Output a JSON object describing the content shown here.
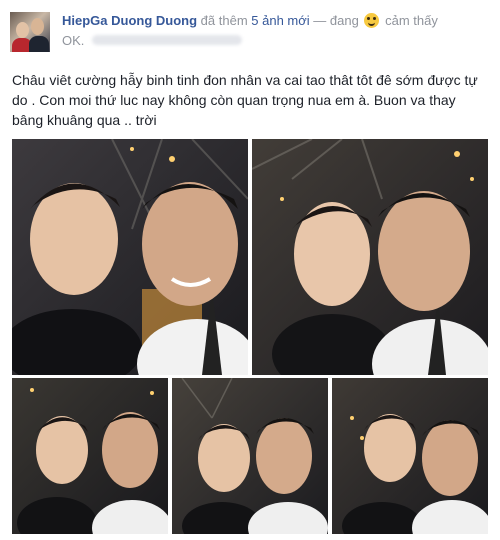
{
  "post": {
    "author": "HiepGa Duong Duong",
    "action_prefix": "đã thêm",
    "photos_link": "5 ảnh mới",
    "feeling_prefix": "— đang",
    "feeling": "cảm thấy",
    "feeling_suffix": "OK.",
    "message": "Châu viêt cường hẫy binh tinh đon nhân va cai tao thât tôt đê sớm được tự do . Con moi thứ luc nay không còn quan trọng nua em à. Buon va thay bâng khuâng qua .. trời"
  },
  "icons": {
    "feeling": "grinning-emoji-icon",
    "avatar": "profile-avatar"
  },
  "photos": [
    {
      "name": "photo-1",
      "alt": "selfie 1"
    },
    {
      "name": "photo-2",
      "alt": "selfie 2"
    },
    {
      "name": "photo-3",
      "alt": "selfie 3"
    },
    {
      "name": "photo-4",
      "alt": "selfie 4"
    },
    {
      "name": "photo-5",
      "alt": "selfie 5"
    }
  ],
  "colors": {
    "link": "#365899",
    "meta": "#90949c",
    "text": "#1d2129"
  }
}
